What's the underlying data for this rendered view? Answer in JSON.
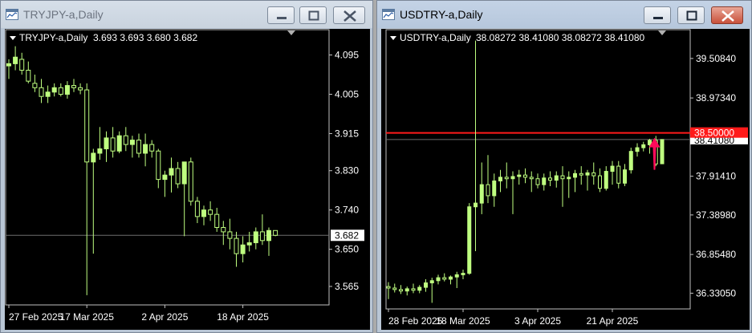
{
  "colors": {
    "chart_bg": "#000000",
    "frame": "#c0c0c0",
    "candle": "#bfff80",
    "candle_body_bear": "#000000",
    "bid_line": "#6e6e6e",
    "level_line": "#ff1a1a",
    "level_label_bg": "#ff1a1a",
    "arrow": "#ff0a5a",
    "window_title_active": "#000000",
    "window_title_inactive": "#6c7480"
  },
  "windows": [
    {
      "id": "left",
      "title": "TRYJPY-a,Daily",
      "active": false,
      "chart_data": {
        "type": "candlestick",
        "header": {
          "symbol": "TRYJPY-a,Daily",
          "ohlc": "3.693 3.693 3.680 3.682"
        },
        "y_ticks": [
          "4.095",
          "4.005",
          "3.915",
          "3.830",
          "3.740",
          "3.650",
          "3.565"
        ],
        "ylim": [
          3.53,
          4.14
        ],
        "x_ticks": [
          {
            "label": "27 Feb 2025",
            "index": 0
          },
          {
            "label": "17 Mar 2025",
            "index": 12
          },
          {
            "label": "2 Apr 2025",
            "index": 24
          },
          {
            "label": "18 Apr 2025",
            "index": 36
          }
        ],
        "current_price": "3.682",
        "current_price_value": 3.682,
        "candles": [
          [
            4.07,
            4.085,
            4.04,
            4.075
          ],
          [
            4.075,
            4.115,
            4.06,
            4.09
          ],
          [
            4.085,
            4.1,
            4.05,
            4.06
          ],
          [
            4.06,
            4.08,
            4.03,
            4.035
          ],
          [
            4.03,
            4.05,
            4.01,
            4.02
          ],
          [
            4.02,
            4.04,
            3.985,
            4.0
          ],
          [
            4.0,
            4.025,
            3.985,
            4.01
          ],
          [
            4.01,
            4.03,
            4.0,
            4.02
          ],
          [
            4.02,
            4.03,
            4.0,
            4.005
          ],
          [
            4.005,
            4.035,
            3.995,
            4.025
          ],
          [
            4.025,
            4.04,
            4.01,
            4.02
          ],
          [
            4.02,
            4.03,
            4.005,
            4.015
          ],
          [
            4.015,
            4.03,
            3.545,
            3.85
          ],
          [
            3.85,
            3.88,
            3.64,
            3.87
          ],
          [
            3.87,
            3.93,
            3.855,
            3.88
          ],
          [
            3.88,
            3.92,
            3.85,
            3.905
          ],
          [
            3.905,
            3.93,
            3.86,
            3.875
          ],
          [
            3.875,
            3.92,
            3.87,
            3.91
          ],
          [
            3.91,
            3.93,
            3.875,
            3.89
          ],
          [
            3.89,
            3.91,
            3.86,
            3.9
          ],
          [
            3.9,
            3.915,
            3.86,
            3.87
          ],
          [
            3.87,
            3.915,
            3.84,
            3.89
          ],
          [
            3.89,
            3.9,
            3.86,
            3.875
          ],
          [
            3.875,
            3.88,
            3.79,
            3.81
          ],
          [
            3.81,
            3.83,
            3.77,
            3.82
          ],
          [
            3.82,
            3.86,
            3.78,
            3.835
          ],
          [
            3.835,
            3.85,
            3.79,
            3.8
          ],
          [
            3.8,
            3.85,
            3.68,
            3.85
          ],
          [
            3.85,
            3.86,
            3.75,
            3.76
          ],
          [
            3.76,
            3.77,
            3.71,
            3.725
          ],
          [
            3.725,
            3.75,
            3.705,
            3.74
          ],
          [
            3.74,
            3.76,
            3.715,
            3.73
          ],
          [
            3.73,
            3.745,
            3.69,
            3.7
          ],
          [
            3.7,
            3.715,
            3.66,
            3.69
          ],
          [
            3.69,
            3.72,
            3.65,
            3.675
          ],
          [
            3.675,
            3.69,
            3.61,
            3.64
          ],
          [
            3.64,
            3.68,
            3.62,
            3.66
          ],
          [
            3.66,
            3.69,
            3.645,
            3.665
          ],
          [
            3.665,
            3.7,
            3.65,
            3.69
          ],
          [
            3.69,
            3.73,
            3.66,
            3.67
          ],
          [
            3.67,
            3.7,
            3.635,
            3.693
          ],
          [
            3.693,
            3.693,
            3.68,
            3.682
          ]
        ]
      }
    },
    {
      "id": "right",
      "title": "USDTRY-a,Daily",
      "active": true,
      "chart_data": {
        "type": "candlestick",
        "header": {
          "symbol": "USDTRY-a,Daily",
          "ohlc": "38.08272 38.41080 38.08272 38.41080"
        },
        "y_ticks": [
          "39.50840",
          "38.97340",
          "37.91410",
          "37.38980",
          "36.85480",
          "36.33050"
        ],
        "ylim": [
          36.15,
          39.8
        ],
        "x_ticks": [
          {
            "label": "28 Feb 2025",
            "index": 0
          },
          {
            "label": "18 Mar 2025",
            "index": 12
          },
          {
            "label": "3 Apr 2025",
            "index": 24
          },
          {
            "label": "21 Apr 2025",
            "index": 36
          }
        ],
        "current_price": "38.41080",
        "current_price_value": 38.4108,
        "level_price": "38.50000",
        "level_value": 38.5,
        "annotation_arrow": {
          "direction": "up",
          "index": 42
        },
        "candles": [
          [
            36.42,
            36.48,
            36.25,
            36.4
          ],
          [
            36.4,
            36.46,
            36.34,
            36.38
          ],
          [
            36.38,
            36.44,
            36.32,
            36.36
          ],
          [
            36.36,
            36.42,
            36.3,
            36.39
          ],
          [
            36.39,
            36.46,
            36.33,
            36.37
          ],
          [
            36.37,
            36.44,
            36.33,
            36.41
          ],
          [
            36.41,
            36.52,
            36.35,
            36.47
          ],
          [
            36.47,
            36.54,
            36.2,
            36.5
          ],
          [
            36.5,
            36.58,
            36.45,
            36.54
          ],
          [
            36.54,
            36.6,
            36.49,
            36.52
          ],
          [
            36.52,
            36.57,
            36.45,
            36.55
          ],
          [
            36.55,
            36.62,
            36.4,
            36.58
          ],
          [
            36.58,
            36.65,
            36.52,
            36.6
          ],
          [
            36.6,
            37.55,
            36.58,
            37.5
          ],
          [
            37.5,
            39.75,
            36.9,
            37.55
          ],
          [
            37.55,
            38.1,
            37.4,
            37.8
          ],
          [
            37.8,
            38.2,
            37.55,
            37.65
          ],
          [
            37.65,
            37.95,
            37.5,
            37.85
          ],
          [
            37.85,
            38.0,
            37.7,
            37.9
          ],
          [
            37.9,
            38.1,
            37.75,
            37.88
          ],
          [
            37.88,
            37.98,
            37.4,
            37.91
          ],
          [
            37.91,
            38.0,
            37.8,
            37.93
          ],
          [
            37.93,
            38.02,
            37.82,
            37.9
          ],
          [
            37.9,
            37.98,
            37.7,
            37.88
          ],
          [
            37.88,
            37.95,
            37.75,
            37.8
          ],
          [
            37.8,
            37.95,
            37.72,
            37.89
          ],
          [
            37.89,
            37.98,
            37.78,
            37.86
          ],
          [
            37.86,
            37.98,
            37.76,
            37.92
          ],
          [
            37.92,
            38.05,
            37.5,
            37.88
          ],
          [
            37.88,
            37.98,
            37.62,
            37.9
          ],
          [
            37.9,
            38.0,
            37.7,
            37.95
          ],
          [
            37.95,
            38.05,
            37.8,
            37.93
          ],
          [
            37.93,
            38.0,
            37.72,
            37.96
          ],
          [
            37.96,
            38.1,
            37.8,
            37.92
          ],
          [
            37.92,
            38.02,
            37.7,
            37.75
          ],
          [
            37.75,
            38.05,
            37.72,
            37.98
          ],
          [
            37.98,
            38.12,
            37.8,
            38.05
          ],
          [
            38.05,
            38.12,
            37.75,
            37.82
          ],
          [
            37.82,
            38.08,
            37.78,
            38.0
          ],
          [
            38.0,
            38.3,
            37.95,
            38.25
          ],
          [
            38.25,
            38.36,
            38.18,
            38.3
          ],
          [
            38.3,
            38.38,
            38.25,
            38.34
          ],
          [
            38.34,
            38.42,
            38.22,
            38.4
          ],
          [
            38.4,
            38.46,
            38.05,
            38.08
          ],
          [
            38.08272,
            38.4108,
            38.08272,
            38.4108
          ]
        ]
      }
    }
  ]
}
